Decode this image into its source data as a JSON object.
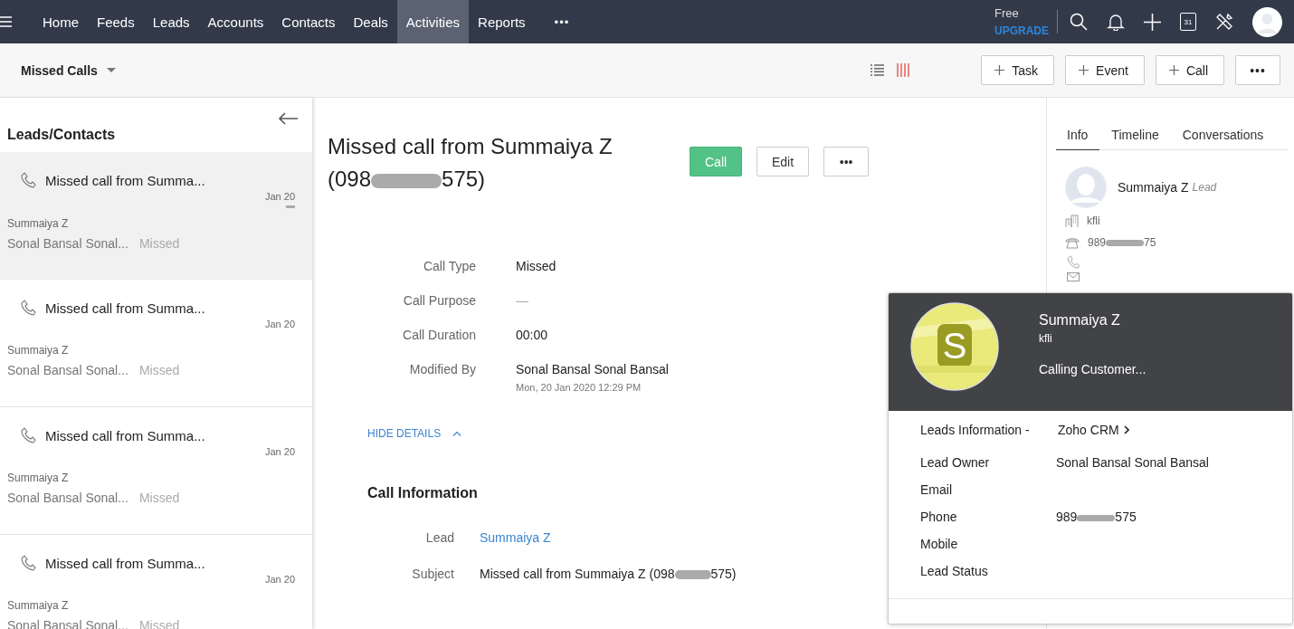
{
  "topbar": {
    "nav": [
      {
        "label": "Home",
        "selected": false
      },
      {
        "label": "Feeds",
        "selected": false
      },
      {
        "label": "Leads",
        "selected": false
      },
      {
        "label": "Accounts",
        "selected": false
      },
      {
        "label": "Contacts",
        "selected": false
      },
      {
        "label": "Deals",
        "selected": false
      },
      {
        "label": "Activities",
        "selected": true
      },
      {
        "label": "Reports",
        "selected": false
      }
    ],
    "more": "•••",
    "plan": "Free",
    "upgrade": "UPGRADE",
    "calendar_day": "31"
  },
  "toolbar": {
    "view": "Missed Calls",
    "buttons": [
      {
        "label": "Task",
        "kind": "add"
      },
      {
        "label": "Event",
        "kind": "add"
      },
      {
        "label": "Call",
        "kind": "add"
      },
      {
        "label": "•••",
        "kind": "more"
      }
    ]
  },
  "list": {
    "title": "Leads/Contacts",
    "items": [
      {
        "title": "Missed call from Summa...",
        "date": "Jan 20",
        "contact": "Summaiya Z",
        "owner": "Sonal Bansal Sonal...",
        "status": "Missed",
        "selected": true
      },
      {
        "title": "Missed call from Summa...",
        "date": "Jan 20",
        "contact": "Summaiya Z",
        "owner": "Sonal Bansal Sonal...",
        "status": "Missed",
        "selected": false
      },
      {
        "title": "Missed call from Summa...",
        "date": "Jan 20",
        "contact": "Summaiya Z",
        "owner": "Sonal Bansal Sonal...",
        "status": "Missed",
        "selected": false
      },
      {
        "title": "Missed call from Summa...",
        "date": "Jan 20",
        "contact": "Summaiya Z",
        "owner": "Sonal Bansal Sonal...",
        "status": "Missed",
        "selected": false
      }
    ]
  },
  "detail": {
    "title": "Missed call from Summaiya Z",
    "title_number": {
      "before": "(098",
      "after": "575)"
    },
    "actions": [
      {
        "label": "Call",
        "kind": "primary"
      },
      {
        "label": "Edit",
        "kind": "default"
      },
      {
        "label": "•••",
        "kind": "default"
      }
    ],
    "fields": [
      {
        "label": "Call Type",
        "value": "Missed"
      },
      {
        "label": "Call Purpose",
        "value": "—",
        "kind": "empty"
      },
      {
        "label": "Call Duration",
        "value": "00:00"
      },
      {
        "label": "Modified By",
        "value": "Sonal Bansal Sonal Bansal",
        "note": "Mon, 20 Jan 2020 12:29 PM"
      }
    ],
    "toggle": "HIDE DETAILS",
    "section": "Call Information",
    "info": [
      {
        "label": "Lead",
        "value": "Summaiya Z",
        "kind": "link"
      },
      {
        "label": "Subject",
        "value": {
          "before": "Missed call from Summaiya Z (098",
          "after": "575)"
        },
        "kind": "redacted"
      }
    ]
  },
  "side": {
    "tabs": [
      {
        "label": "Info",
        "selected": true
      },
      {
        "label": "Timeline",
        "selected": false
      },
      {
        "label": "Conversations",
        "selected": false
      }
    ],
    "name": "Summaiya Z",
    "type": "Lead",
    "company": "kfli",
    "phone": {
      "before": "989",
      "after": "75"
    }
  },
  "popup": {
    "initial": "S",
    "name": "Summaiya Z",
    "company": "kfli",
    "status": "Calling Customer...",
    "source_label": "Leads Information -",
    "source": "Zoho CRM",
    "fields": [
      {
        "label": "Lead Owner",
        "value": "Sonal Bansal Sonal Bansal"
      },
      {
        "label": "Email"
      },
      {
        "label": "Phone",
        "value": {
          "before": "989",
          "after": "575"
        }
      },
      {
        "label": "Mobile"
      },
      {
        "label": "Lead Status"
      }
    ]
  }
}
